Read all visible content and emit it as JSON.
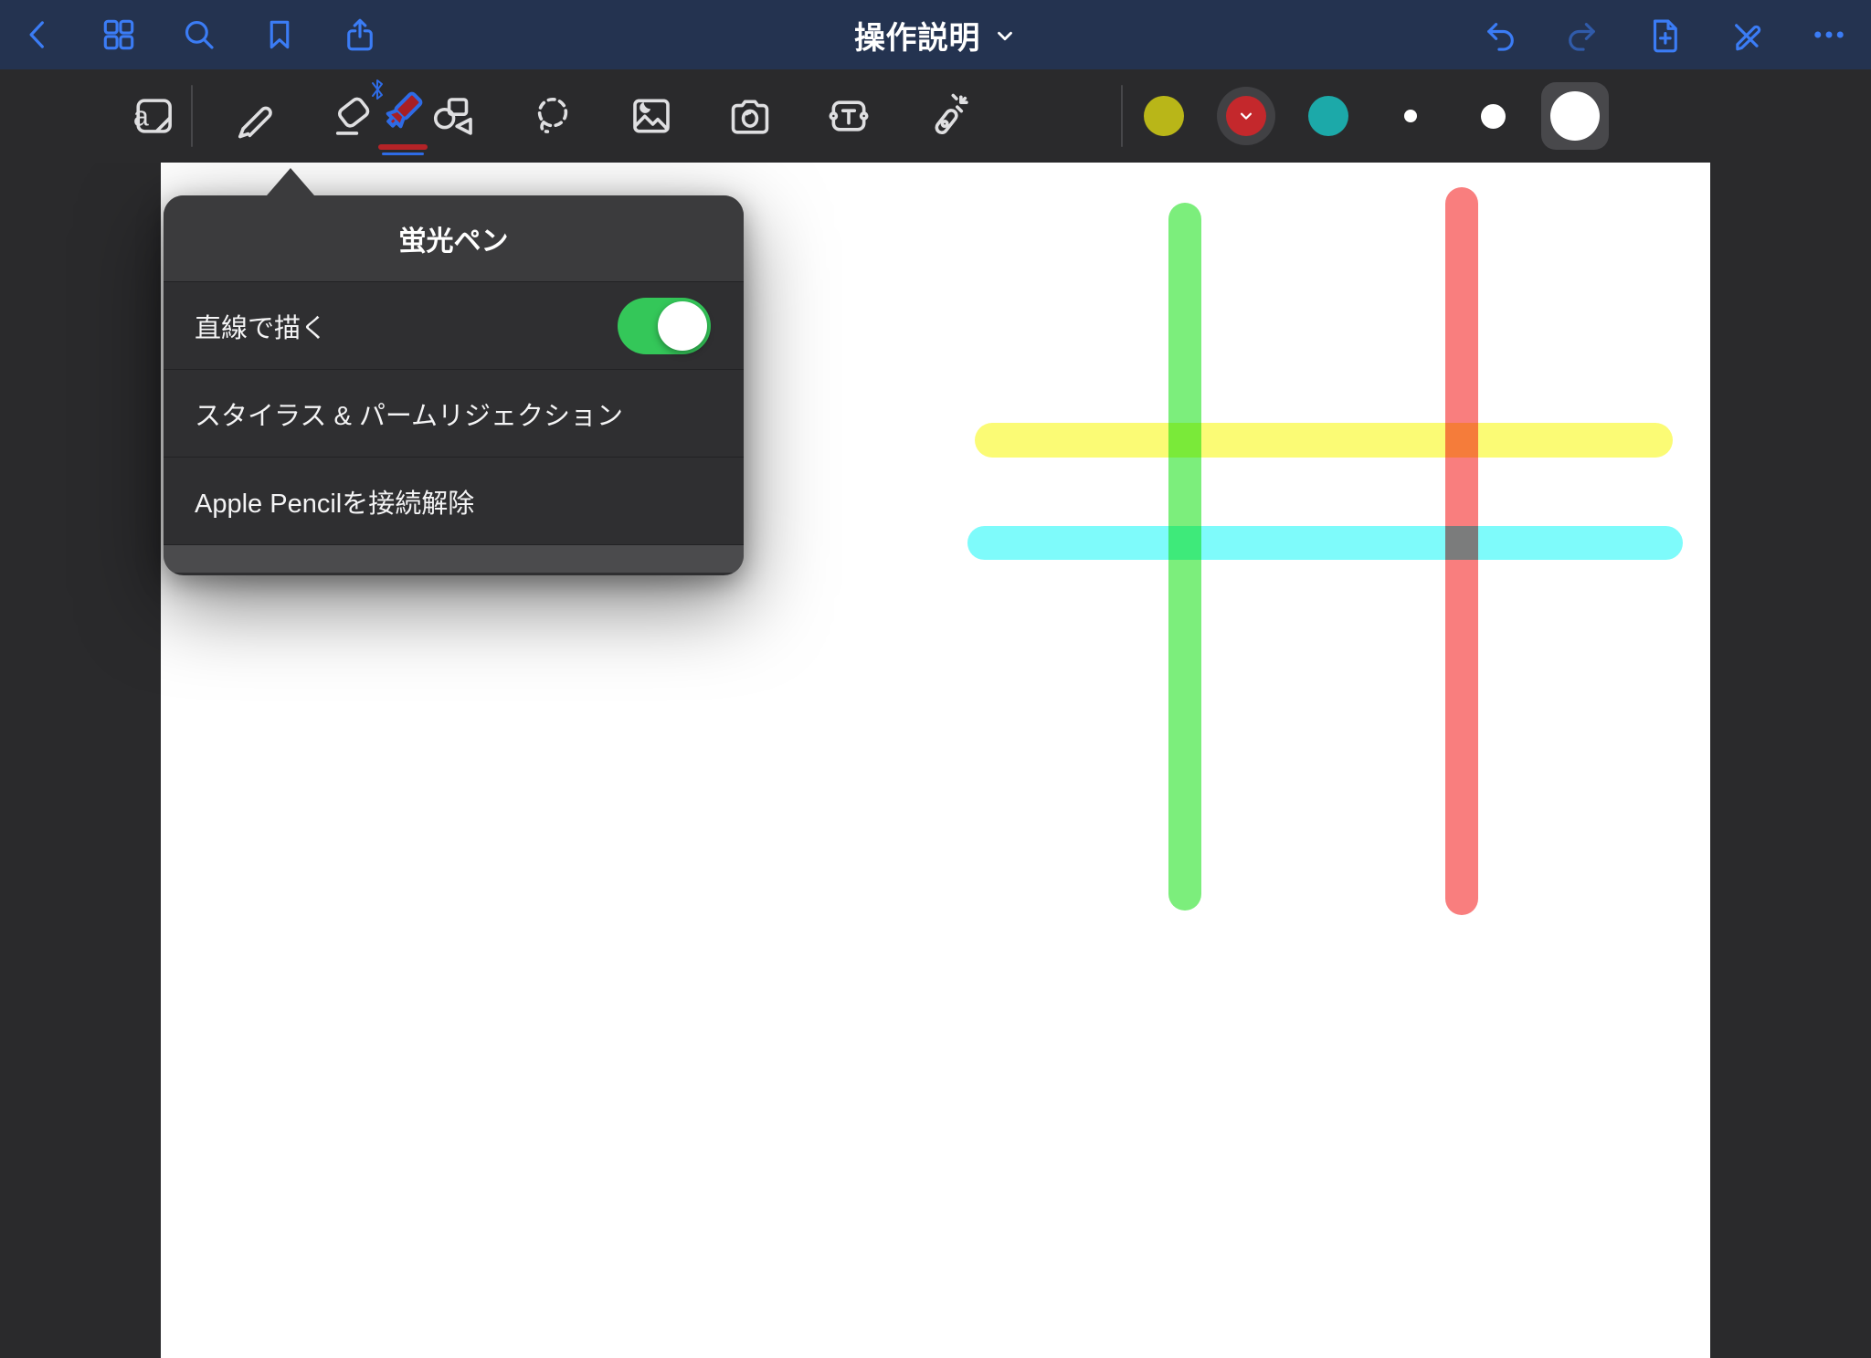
{
  "topbar": {
    "title": "操作説明",
    "left_icons": [
      "back",
      "document-grid",
      "search",
      "bookmark",
      "share"
    ],
    "right_icons": [
      "undo",
      "redo",
      "add-page",
      "exit-edit",
      "more"
    ]
  },
  "toolbar": {
    "tools": [
      "panel",
      "pen",
      "eraser",
      "highlighter",
      "shapes",
      "lasso",
      "image",
      "camera",
      "text",
      "laser-pointer"
    ],
    "selected_tool": "highlighter",
    "selected_color": "red",
    "selected_size": "large"
  },
  "popover": {
    "title": "蛍光ペン",
    "rows": [
      {
        "label": "直線で描く",
        "control": "toggle",
        "state": "on"
      },
      {
        "label": "スタイラス & パームリジェクション"
      },
      {
        "label": "Apple Pencilを接続解除"
      }
    ]
  },
  "colors": {
    "accent_blue": "#3b7cf5",
    "toggle_green": "#34c759",
    "swatch_yellow": "#b9b618",
    "swatch_red": "#c4282c",
    "swatch_teal": "#1ca9a9",
    "stroke_green": "#7cee7c",
    "stroke_red": "#f97e7e",
    "stroke_yellow": "#fbfb75",
    "stroke_cyan": "#7efbfb"
  },
  "canvas": {
    "strokes": [
      {
        "name": "green-vertical-line",
        "orientation": "vertical"
      },
      {
        "name": "red-vertical-line",
        "orientation": "vertical"
      },
      {
        "name": "yellow-horizontal-line",
        "orientation": "horizontal"
      },
      {
        "name": "cyan-horizontal-line",
        "orientation": "horizontal"
      }
    ]
  }
}
